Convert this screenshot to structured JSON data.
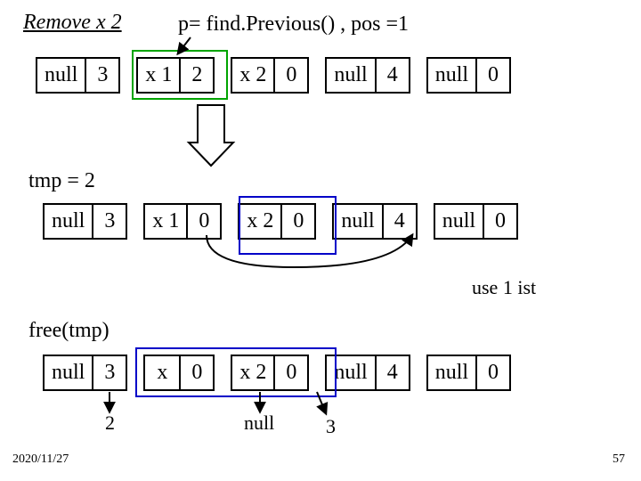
{
  "title": "Remove x 2",
  "p_line": "p= find.Previous() , pos =1",
  "tmp_label": "tmp = 2",
  "free_label": "free(tmp)",
  "use_list": "use 1 ist",
  "row1": [
    {
      "a": "null",
      "b": "3"
    },
    {
      "a": "x 1",
      "b": "2"
    },
    {
      "a": "x 2",
      "b": "0"
    },
    {
      "a": "null",
      "b": "4"
    },
    {
      "a": "null",
      "b": "0"
    }
  ],
  "row2": [
    {
      "a": "null",
      "b": "3"
    },
    {
      "a": "x 1",
      "b": "0"
    },
    {
      "a": "x 2",
      "b": "0"
    },
    {
      "a": "null",
      "b": "4"
    },
    {
      "a": "null",
      "b": "0"
    }
  ],
  "row3": [
    {
      "a": "null",
      "b": "3"
    },
    {
      "a": "x",
      "b": "0"
    },
    {
      "a": "x 2",
      "b": "0"
    },
    {
      "a": "null",
      "b": "4"
    },
    {
      "a": "null",
      "b": "0"
    }
  ],
  "after3_a": "2",
  "after3_b": "null",
  "after3_c": "3",
  "footer_date": "2020/11/27",
  "footer_page": "57"
}
